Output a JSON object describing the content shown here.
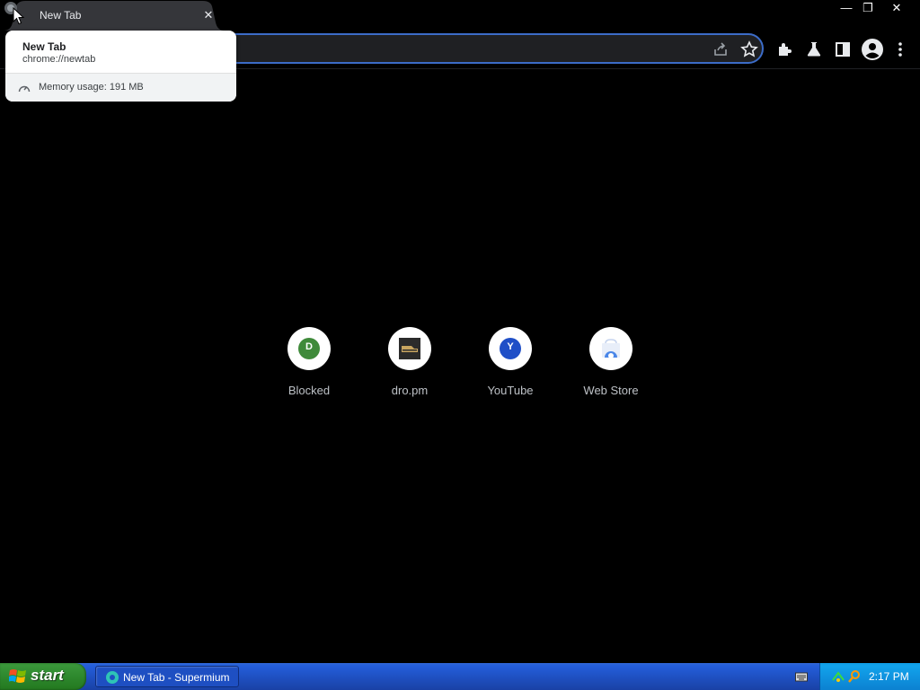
{
  "browser": {
    "tab": {
      "title": "New Tab",
      "close_glyph": "✕"
    },
    "window_controls": {
      "minimize_glyph": "—",
      "restore_glyph": "❐",
      "close_glyph": "✕"
    }
  },
  "hovercard": {
    "title": "New Tab",
    "url": "chrome://newtab",
    "memory": "Memory usage: 191 MB"
  },
  "toolbar_icons": [
    "share-icon",
    "bookmark-star-icon",
    "extensions-icon",
    "labs-flask-icon",
    "side-panel-icon",
    "profile-icon",
    "menu-icon"
  ],
  "shortcuts": [
    {
      "label": "Blocked",
      "letter": "D",
      "color": "#3f8a3a"
    },
    {
      "label": "dro.pm",
      "letter": "",
      "color": "#2b2b2b"
    },
    {
      "label": "YouTube",
      "letter": "Y",
      "color": "#1f4fc7"
    },
    {
      "label": "Web Store",
      "letter": "",
      "color": "#4a86e8"
    }
  ],
  "taskbar": {
    "start_label": "start",
    "task_label": "New Tab - Supermium",
    "clock": "2:17 PM"
  },
  "colors": {
    "omnibox_focus": "#3c6cc8",
    "taskbar": "#245edb",
    "start_button": "#2f8a2f"
  }
}
